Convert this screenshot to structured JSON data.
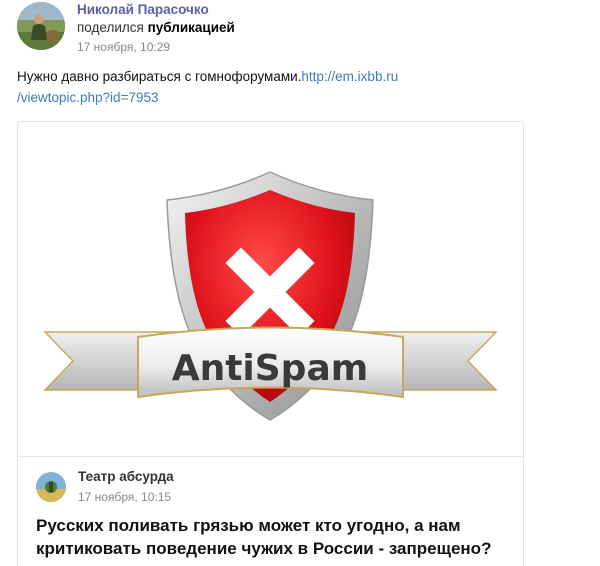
{
  "post": {
    "author": "Николай Парасочко",
    "action_prefix": "поделился",
    "action_bold": "публикацией",
    "time": "17 ноября, 10:29",
    "text": "Нужно давно разбираться с гомнофорумами.",
    "link": "http://em.ixbb.ru/viewtopic.php?id=7953",
    "link_line1": "http://em.ixbb.ru",
    "link_line2": "/viewtopic.php?id=7953"
  },
  "card": {
    "image_logo_text": "AntiSpam",
    "group_name": "Театр абсурда",
    "group_time": "17 ноября, 10:15",
    "title": "Русских поливать грязью может кто угодно, а нам критиковать поведение чужих в России - запрещено?"
  },
  "colors": {
    "author_name": "#5a5fa8",
    "link": "#3d7bbd",
    "shield_red": "#e0121b",
    "shield_silver": "#c9c9c9"
  },
  "icons": {
    "author_avatar": "user-photo",
    "group_avatar": "group-photo",
    "image_logo": "antispam-shield"
  }
}
